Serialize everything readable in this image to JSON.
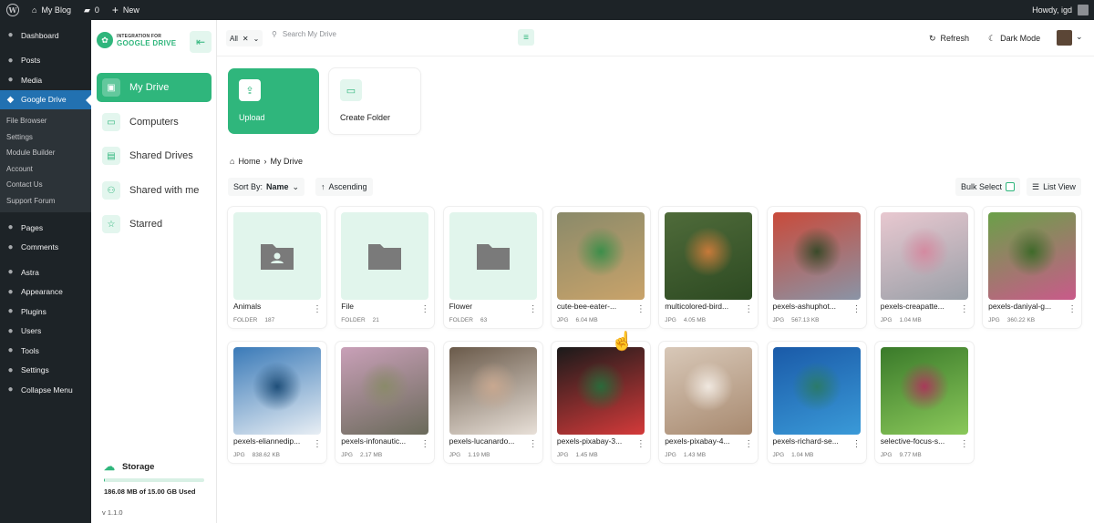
{
  "admin_bar": {
    "site_name": "My Blog",
    "comments_count": "0",
    "new_label": "New",
    "greeting": "Howdy, igd"
  },
  "wp_menu": {
    "items_top": [
      {
        "label": "Dashboard",
        "icon": "dashboard-icon"
      }
    ],
    "items_mid": [
      {
        "label": "Posts",
        "icon": "pin-icon"
      },
      {
        "label": "Media",
        "icon": "media-icon"
      }
    ],
    "active": {
      "label": "Google Drive",
      "icon": "google-drive-icon"
    },
    "submenu": [
      "File Browser",
      "Settings",
      "Module Builder",
      "Account",
      "Contact Us",
      "Support Forum"
    ],
    "items_bottom": [
      {
        "label": "Pages",
        "icon": "page-icon"
      },
      {
        "label": "Comments",
        "icon": "comment-icon"
      }
    ],
    "items_last": [
      {
        "label": "Astra",
        "icon": "astra-icon"
      },
      {
        "label": "Appearance",
        "icon": "brush-icon"
      },
      {
        "label": "Plugins",
        "icon": "plug-icon"
      },
      {
        "label": "Users",
        "icon": "user-icon"
      },
      {
        "label": "Tools",
        "icon": "wrench-icon"
      },
      {
        "label": "Settings",
        "icon": "settings-icon"
      },
      {
        "label": "Collapse Menu",
        "icon": "collapse-icon"
      }
    ]
  },
  "plugin": {
    "logo_line1": "INTEGRATION FOR",
    "logo_line2": "GOOGLE DRIVE",
    "nav": [
      {
        "label": "My Drive",
        "icon": "drive-icon",
        "active": true
      },
      {
        "label": "Computers",
        "icon": "computer-icon",
        "active": false
      },
      {
        "label": "Shared Drives",
        "icon": "shared-drive-icon",
        "active": false
      },
      {
        "label": "Shared with me",
        "icon": "shared-with-me-icon",
        "active": false
      },
      {
        "label": "Starred",
        "icon": "star-icon",
        "active": false
      }
    ],
    "storage": {
      "title": "Storage",
      "used_text": "186.08 MB of 15.00 GB Used",
      "used_fraction": 0.012
    },
    "version": "v 1.1.0"
  },
  "topbar": {
    "filter_value": "All",
    "search_placeholder": "Search My Drive",
    "refresh_label": "Refresh",
    "dark_mode_label": "Dark Mode"
  },
  "actions": {
    "upload_label": "Upload",
    "create_folder_label": "Create Folder"
  },
  "breadcrumb": {
    "home": "Home",
    "current": "My Drive"
  },
  "toolbar": {
    "sort_prefix": "Sort By:",
    "sort_value": "Name",
    "order_label": "Ascending",
    "bulk_label": "Bulk Select",
    "list_view_label": "List View"
  },
  "colors": {
    "accent": "#2fb67c",
    "accent_light": "#e3f6ee",
    "admin_bg": "#1d2327",
    "active_blue": "#2271b1"
  },
  "files": [
    {
      "name": "Animals",
      "type": "FOLDER",
      "size": "187",
      "kind": "folder-shared",
      "colors": []
    },
    {
      "name": "File",
      "type": "FOLDER",
      "size": "21",
      "kind": "folder",
      "colors": []
    },
    {
      "name": "Flower",
      "type": "FOLDER",
      "size": "63",
      "kind": "folder",
      "colors": []
    },
    {
      "name": "cute-bee-eater-...",
      "type": "JPG",
      "size": "6.04 MB",
      "kind": "image",
      "colors": [
        "#8a8a6a",
        "#c9a36a",
        "#3d8e4a"
      ]
    },
    {
      "name": "multicolored-bird...",
      "type": "JPG",
      "size": "4.05 MB",
      "kind": "image",
      "colors": [
        "#4f6b3a",
        "#2d4a22",
        "#c77a3a"
      ]
    },
    {
      "name": "pexels-ashuphot...",
      "type": "JPG",
      "size": "567.13 KB",
      "kind": "image",
      "colors": [
        "#c94a3a",
        "#8a94a6",
        "#3a4a2a"
      ]
    },
    {
      "name": "pexels-creapatte...",
      "type": "JPG",
      "size": "1.04 MB",
      "kind": "image",
      "colors": [
        "#e8c8d0",
        "#9aa0a8",
        "#d48aa0"
      ]
    },
    {
      "name": "pexels-daniyal-g...",
      "type": "JPG",
      "size": "360.22 KB",
      "kind": "image",
      "colors": [
        "#6aa048",
        "#c95a8a",
        "#3f6a2a"
      ]
    },
    {
      "name": "pexels-eliannedip...",
      "type": "JPG",
      "size": "838.62 KB",
      "kind": "image",
      "colors": [
        "#3a7ab8",
        "#e8eef4",
        "#1f4f7a"
      ]
    },
    {
      "name": "pexels-infonautic...",
      "type": "JPG",
      "size": "2.17 MB",
      "kind": "image",
      "colors": [
        "#c9a0b8",
        "#6a6a5a",
        "#8a8a6a"
      ]
    },
    {
      "name": "pexels-lucanardo...",
      "type": "JPG",
      "size": "1.19 MB",
      "kind": "image",
      "colors": [
        "#6a5a4a",
        "#e8e0d8",
        "#c8a890"
      ]
    },
    {
      "name": "pexels-pixabay-3...",
      "type": "JPG",
      "size": "1.45 MB",
      "kind": "image",
      "colors": [
        "#1a1a1a",
        "#d43a3a",
        "#2a6a3a"
      ]
    },
    {
      "name": "pexels-pixabay-4...",
      "type": "JPG",
      "size": "1.43 MB",
      "kind": "image",
      "colors": [
        "#d8c8b8",
        "#a88a70",
        "#f0e8e0"
      ]
    },
    {
      "name": "pexels-richard-se...",
      "type": "JPG",
      "size": "1.04 MB",
      "kind": "image",
      "colors": [
        "#1a5aa8",
        "#3a9ad8",
        "#2a7a6a"
      ]
    },
    {
      "name": "selective-focus-s...",
      "type": "JPG",
      "size": "9.77 MB",
      "kind": "image",
      "colors": [
        "#3a7a2a",
        "#8ac85a",
        "#a83a5a"
      ]
    }
  ]
}
